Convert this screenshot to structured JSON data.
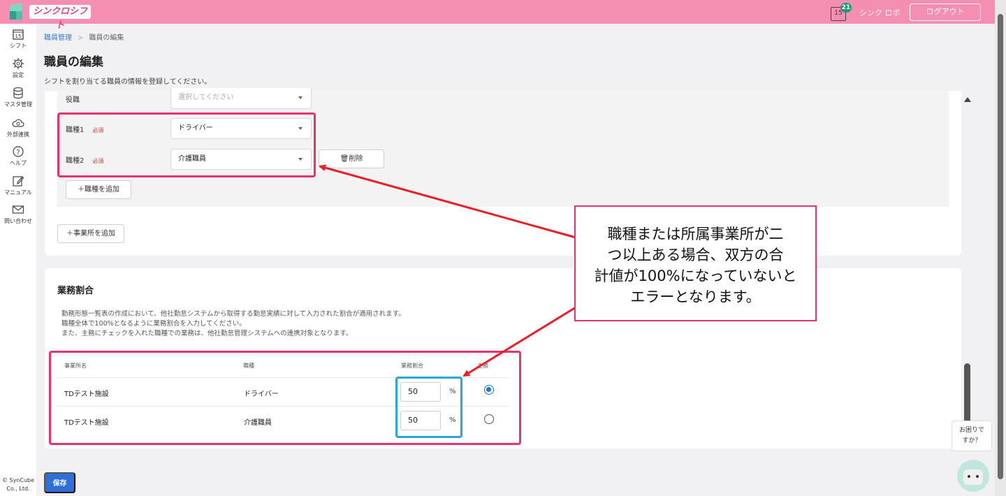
{
  "header": {
    "app_name": "シンクロシフト",
    "notification_count": "21",
    "calendar_day": "15",
    "user_name": "シンク ロボ",
    "logout_label": "ログアウト"
  },
  "sidebar": {
    "items": [
      {
        "label": "シフト",
        "icon": "calendar-icon"
      },
      {
        "label": "設定",
        "icon": "gear-icon"
      },
      {
        "label": "マスタ管理",
        "icon": "database-icon"
      },
      {
        "label": "外部連携",
        "icon": "cloud-sync-icon"
      },
      {
        "label": "ヘルプ",
        "icon": "help-icon"
      },
      {
        "label": "マニュアル",
        "icon": "edit-icon"
      },
      {
        "label": "問い合わせ",
        "icon": "mail-icon"
      }
    ],
    "calendar_day": "15",
    "copyright_line1": "© SynCube",
    "copyright_line2": "Co., Ltd."
  },
  "breadcrumb": {
    "parent": "職員管理",
    "separator": ">",
    "current": "職員の編集"
  },
  "page": {
    "title": "職員の編集",
    "description": "シフトを割り当てる職員の情報を登録してください。"
  },
  "position_form": {
    "role_label": "役職",
    "role_placeholder": "選択してください",
    "job1_label": "職種1",
    "job1_required": "必須",
    "job1_value": "ドライバー",
    "job2_label": "職種2",
    "job2_required": "必須",
    "job2_value": "介護職員",
    "delete_label": "🗑削除",
    "add_job_label": "＋職種を追加",
    "add_office_label": "＋事業所を追加"
  },
  "ratio_section": {
    "title": "業務割合",
    "desc_lines": [
      "勤務形態一覧表の作成において、他社勤怠システムから取得する勤怠実績に対して入力された割合が適用されます。",
      "職種全体で100%となるように業務割合を入力してください。",
      "また、主務にチェックを入れた職種での業務は、他社勤怠管理システムへの連携対象となります。"
    ],
    "columns": [
      "事業所名",
      "職種",
      "業務割合",
      "主務"
    ],
    "rows": [
      {
        "office": "TDテスト施設",
        "job": "ドライバー",
        "ratio": "50",
        "unit": "%",
        "primary": true
      },
      {
        "office": "TDテスト施設",
        "job": "介護職員",
        "ratio": "50",
        "unit": "%",
        "primary": false
      }
    ]
  },
  "save_label": "保存",
  "annotation": {
    "lines": [
      "職種または所属事業所が二",
      "つ以上ある場合、双方の合",
      "計値が100%になっていないと",
      "エラーとなります。"
    ],
    "color": "#e8336f",
    "input_highlight_color": "#27a6e0"
  },
  "help_widget": {
    "line1": "お困りで",
    "line2": "すか？"
  },
  "colors": {
    "header": "#f48fb1",
    "primary_button": "#2f6fd9",
    "required": "#d23a3a"
  }
}
